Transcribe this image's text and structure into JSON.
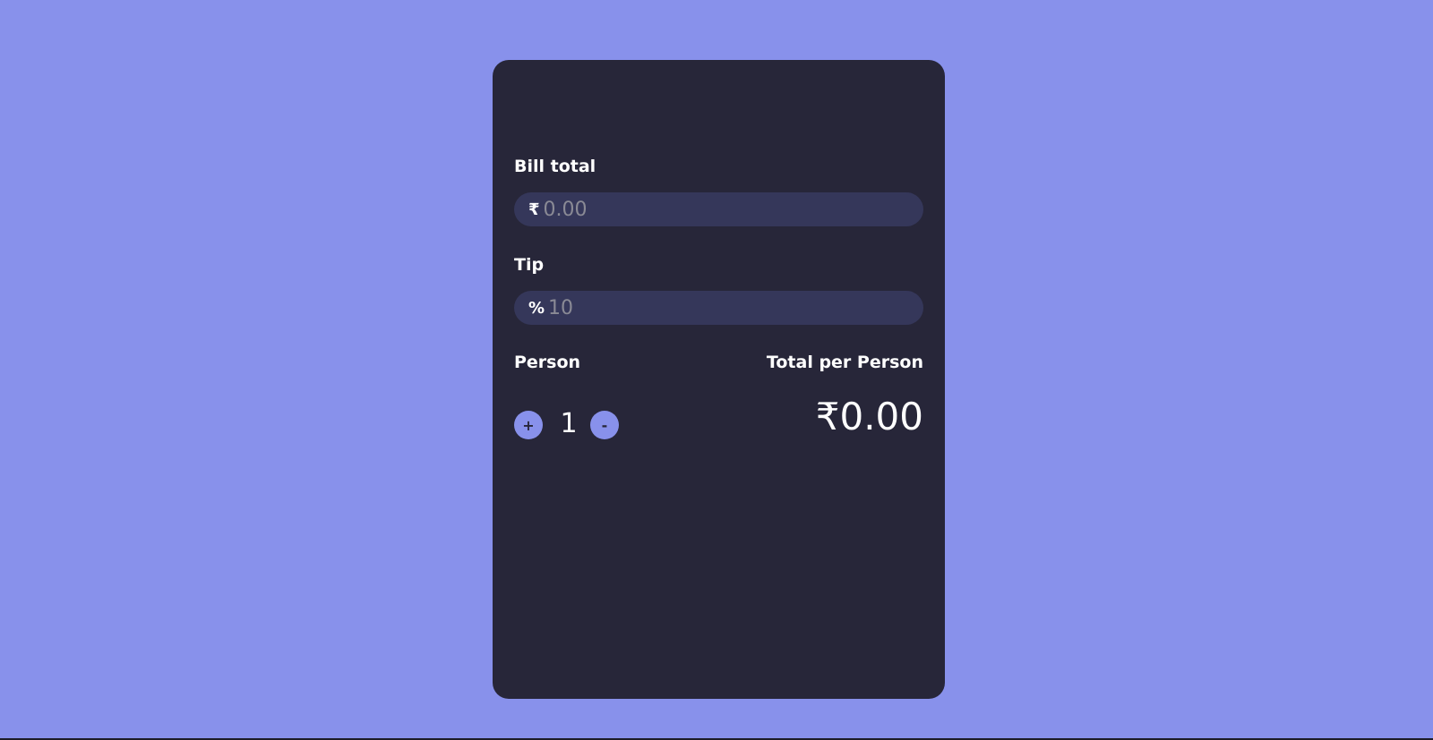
{
  "colors": {
    "background": "#8891eb",
    "card": "#272639",
    "input_bg": "#35375a",
    "accent": "#8891eb"
  },
  "bill": {
    "label": "Bill total",
    "prefix": "₹",
    "placeholder": "0.00",
    "value": ""
  },
  "tip": {
    "label": "Tip",
    "prefix": "%",
    "placeholder": "10",
    "value": ""
  },
  "person": {
    "label": "Person",
    "increment_label": "+",
    "decrement_label": "-",
    "count": "1"
  },
  "total": {
    "label": "Total per Person",
    "amount": "₹0.00"
  }
}
